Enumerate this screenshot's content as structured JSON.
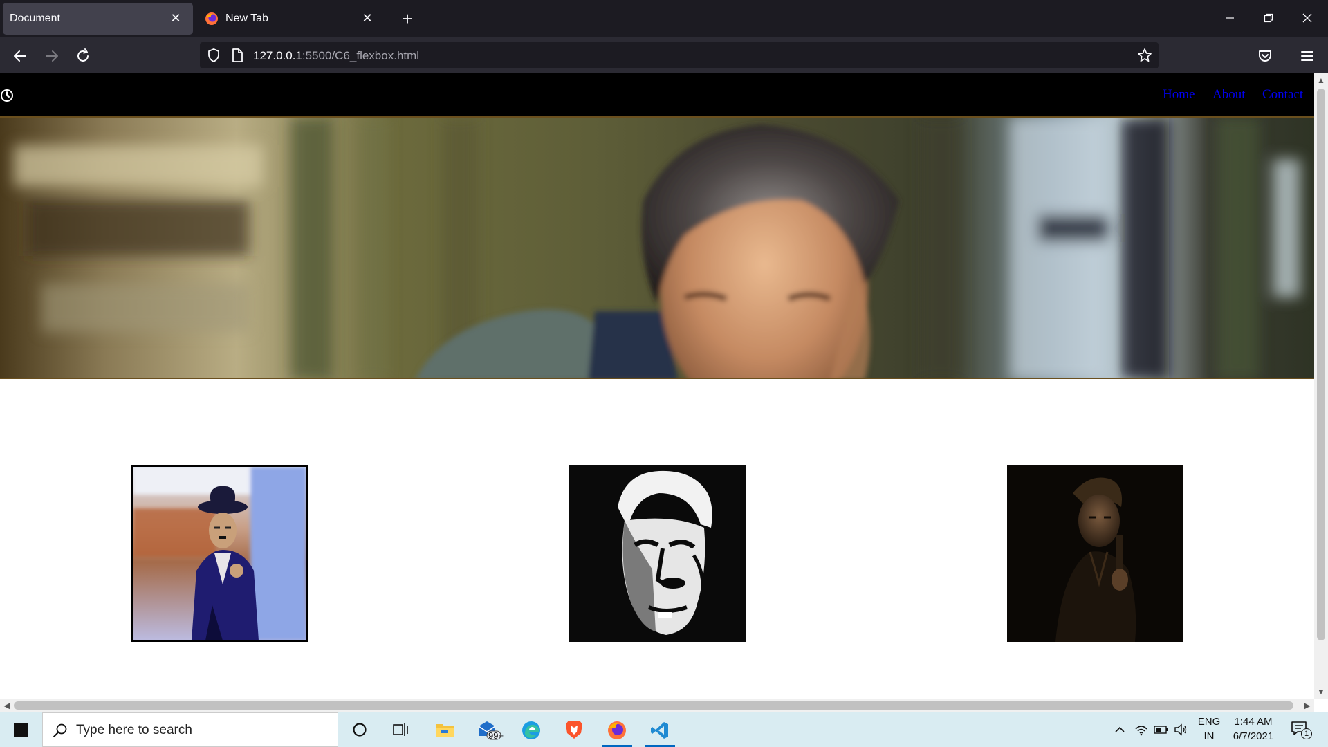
{
  "browser": {
    "tabs": [
      {
        "title": "Document",
        "active": true
      },
      {
        "title": "New Tab",
        "active": false
      }
    ],
    "url": {
      "host": "127.0.0.1",
      "rest": ":5500/C6_flexbox.html"
    }
  },
  "site": {
    "nav": [
      {
        "label": "Home"
      },
      {
        "label": "About"
      },
      {
        "label": "Contact"
      }
    ]
  },
  "taskbar": {
    "search_placeholder": "Type here to search",
    "mail_badge": "99+",
    "lang_line1": "ENG",
    "lang_line2": "IN",
    "time": "1:44 AM",
    "date": "6/7/2021",
    "notification_count": "1"
  },
  "colors": {
    "link": "#0000ee",
    "banner_border": "#6a4f1e",
    "taskbar_bg": "#d9ecf2",
    "chrome_dark": "#1c1b22"
  }
}
